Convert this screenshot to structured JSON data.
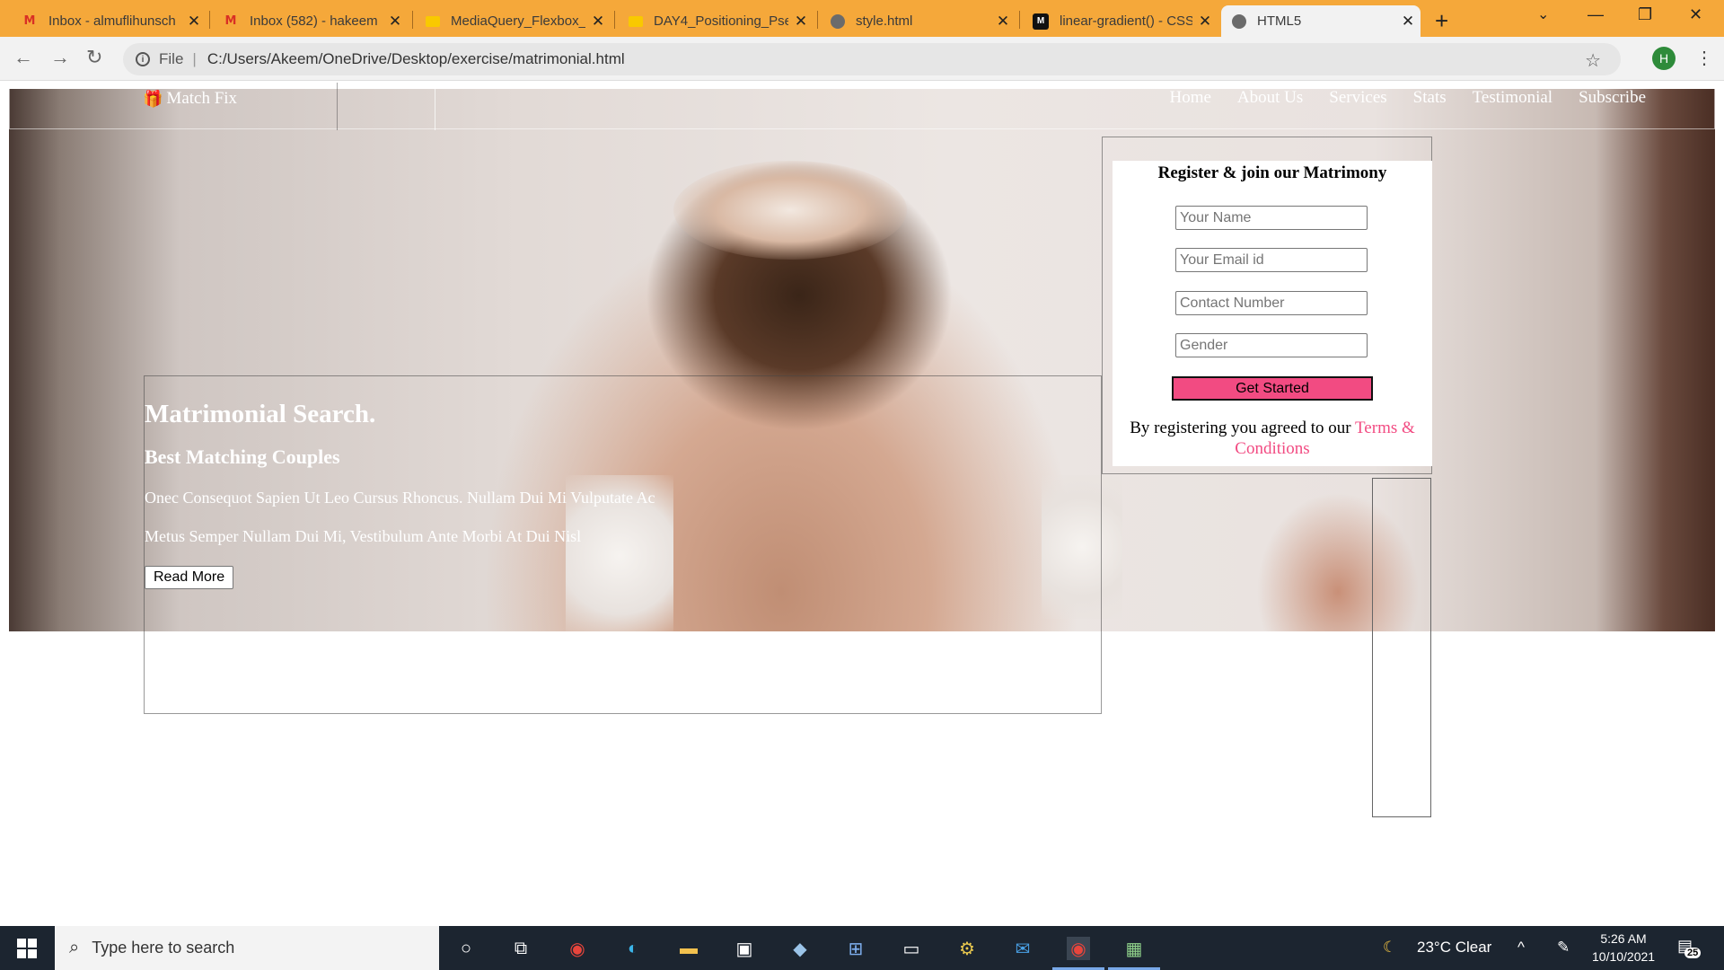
{
  "browser": {
    "tabs": [
      {
        "title": "Inbox - almuflihunsch",
        "icon": "gmail-icon"
      },
      {
        "title": "Inbox (582) - hakeem",
        "icon": "gmail-icon"
      },
      {
        "title": "MediaQuery_Flexbox_",
        "icon": "slides-icon"
      },
      {
        "title": "DAY4_Positioning_Pse",
        "icon": "slides-icon"
      },
      {
        "title": "style.html",
        "icon": "globe-icon"
      },
      {
        "title": "linear-gradient() - CSS",
        "icon": "mdn-icon"
      },
      {
        "title": "HTML5",
        "icon": "globe-icon",
        "active": true
      }
    ],
    "address": {
      "scheme_label": "File",
      "url": "C:/Users/Akeem/OneDrive/Desktop/exercise/matrimonial.html"
    },
    "profile_initial": "H"
  },
  "page": {
    "brand": "Match Fix",
    "nav": [
      "Home",
      "About Us",
      "Services",
      "Stats",
      "Testimonial",
      "Subscribe"
    ],
    "hero": {
      "title": "Matrimonial Search.",
      "subtitle": "Best Matching Couples",
      "line1": "Onec Consequot Sapien Ut Leo Cursus Rhoncus. Nullam Dui Mi Vulputate Ac",
      "line2": "Metus Semper Nullam Dui Mi, Vestibulum Ante Morbi At Dui Nisl",
      "button": "Read More"
    },
    "form": {
      "heading": "Register & join our Matrimony",
      "placeholders": {
        "name": "Your Name",
        "email": "Your Email id",
        "contact": "Contact Number",
        "gender": "Gender"
      },
      "button": "Get Started",
      "terms_prefix": "By registering you agreed to our ",
      "terms_link": "Terms & Conditions"
    },
    "colors": {
      "accent": "#f24b82"
    }
  },
  "taskbar": {
    "search_placeholder": "Type here to search",
    "weather": "23°C  Clear",
    "time": "5:26 AM",
    "date": "10/10/2021",
    "notifications": "25"
  }
}
